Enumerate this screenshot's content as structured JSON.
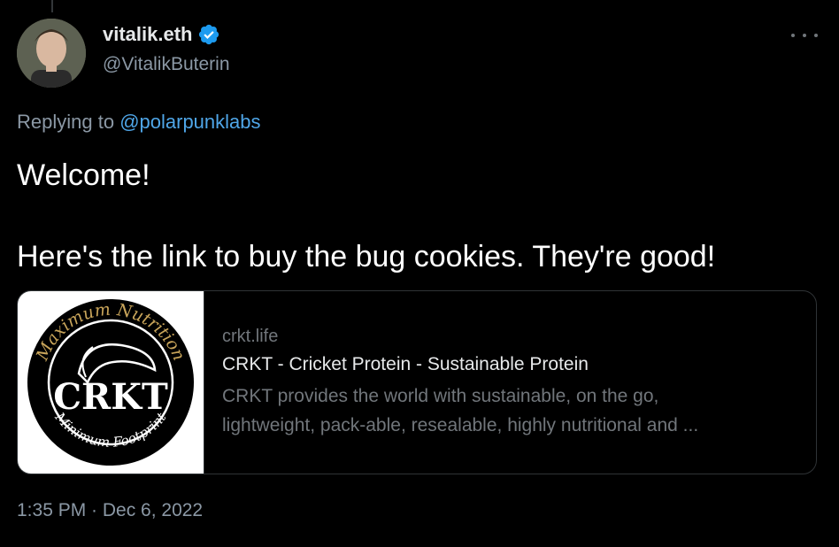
{
  "tweet": {
    "display_name": "vitalik.eth",
    "handle": "@VitalikButerin",
    "replying_prefix": "Replying to ",
    "replying_to": "@polarpunklabs",
    "text_line1": "Welcome!",
    "text_line2": "Here's the link to buy the bug cookies. They're good!",
    "timestamp": "1:35 PM · Dec 6, 2022"
  },
  "card": {
    "domain": "crkt.life",
    "title": "CRKT - Cricket Protein - Sustainable Protein",
    "description_line1": "CRKT provides the world with sustainable, on the go,",
    "description_line2": "lightweight, pack-able, resealable, highly nutritional and ...",
    "logo": {
      "top_text": "Maximum Nutrition",
      "center_text": "CRKT",
      "bottom_text": "Minimum Footprint"
    }
  },
  "icons": {
    "verified": "verified-badge-icon",
    "more": "more-options-icon"
  },
  "colors": {
    "background": "#000000",
    "link": "#4fa6e8",
    "secondary_text": "#8b98a5",
    "verified": "#1d9bf0"
  }
}
